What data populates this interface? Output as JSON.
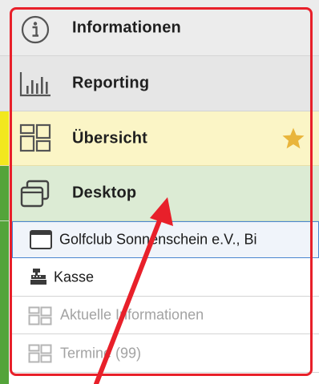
{
  "menu": {
    "items": [
      {
        "label": "Informationen",
        "icon": "info-circle-icon",
        "background": "#ececec",
        "band": "#ececec"
      },
      {
        "label": "Reporting",
        "icon": "bar-chart-icon",
        "background": "#e6e6e6",
        "band": "#e6e6e6"
      },
      {
        "label": "Übersicht",
        "icon": "dashboard-icon",
        "background": "#fbf5c6",
        "band": "#f2e81e",
        "favorite_icon": "star-icon",
        "favorite_color": "#e9b53c"
      },
      {
        "label": "Desktop",
        "icon": "windows-icon",
        "background": "#dcebd4",
        "band": "#54a43a"
      }
    ],
    "desktop_children": [
      {
        "label": "Golfclub Sonnenschein e.V., Bi",
        "icon": "window-icon"
      },
      {
        "label": "Kasse",
        "icon": "cash-register-icon"
      },
      {
        "label": "Aktuelle Informationen",
        "icon": "dashboard-small-icon",
        "muted": true
      },
      {
        "label": "Termine (99)",
        "icon": "dashboard-small-icon",
        "muted": true
      }
    ]
  },
  "annotation": {
    "color": "#e8202a"
  }
}
